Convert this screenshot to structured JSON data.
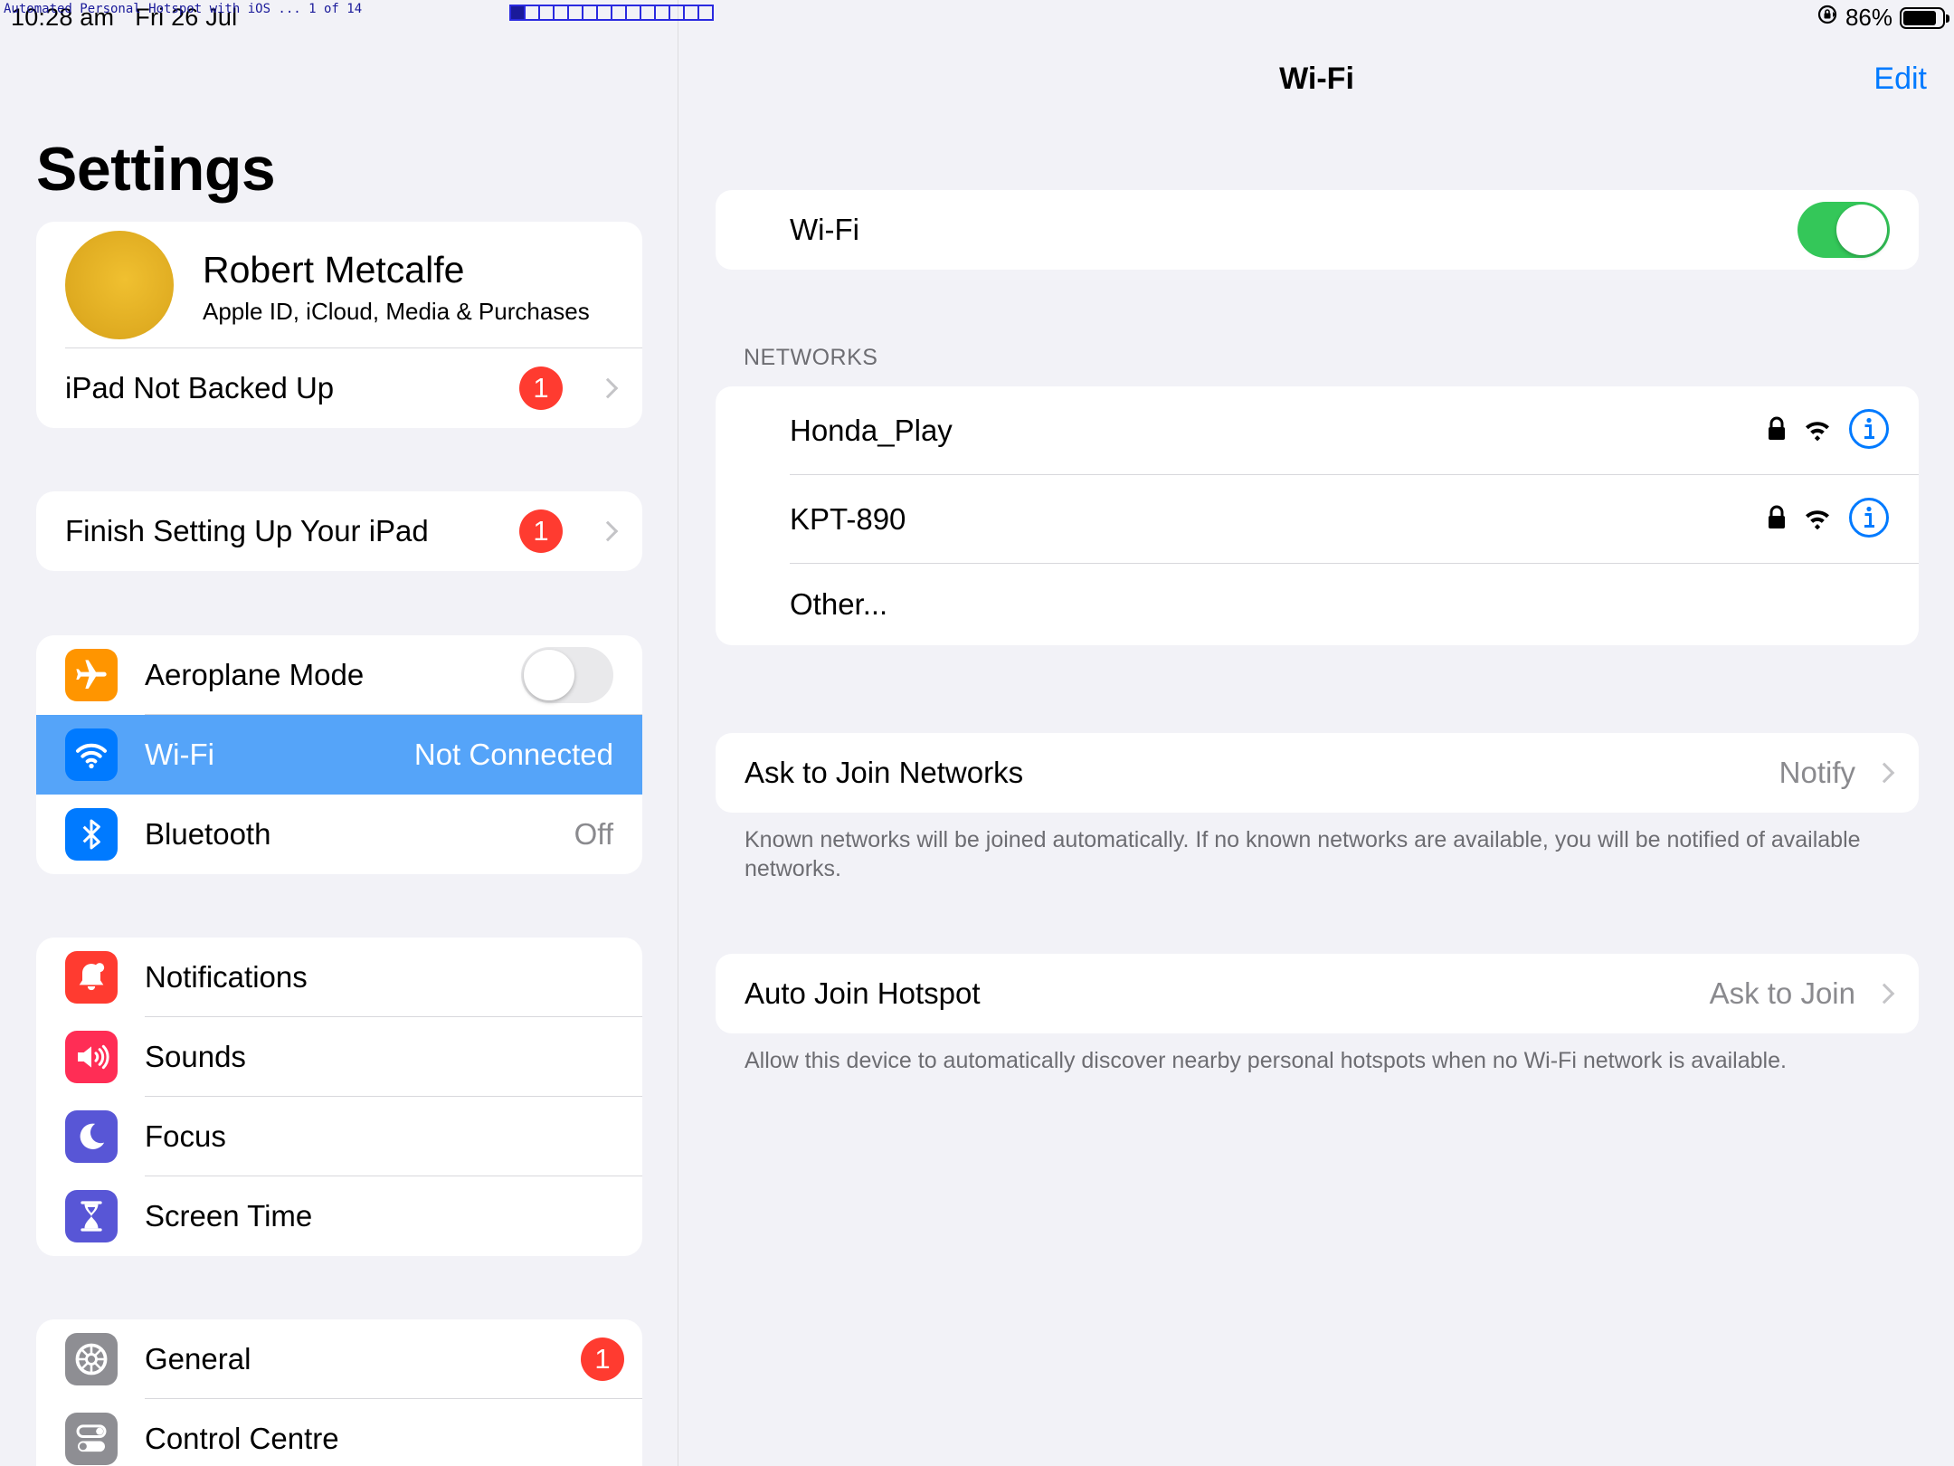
{
  "status": {
    "time": "10:28 am",
    "date": "Fri 26 Jul",
    "recording_label": "Automated Personal Hotspot with iOS ... 1 of 14",
    "recording_current": 1,
    "recording_total": 14,
    "battery": "86%",
    "battery_level": 0.86
  },
  "sidebar": {
    "title": "Settings",
    "profile": {
      "name": "Robert Metcalfe",
      "subtitle": "Apple ID, iCloud, Media & Purchases"
    },
    "backup": {
      "label": "iPad Not Backed Up",
      "badge": "1"
    },
    "setup": {
      "label": "Finish Setting Up Your iPad",
      "badge": "1"
    },
    "connectivity": [
      {
        "label": "Aeroplane Mode",
        "icon": "airplane-icon",
        "color": "#ff9500",
        "toggle": false
      },
      {
        "label": "Wi-Fi",
        "icon": "wifi-icon",
        "color": "#007aff",
        "value": "Not Connected"
      },
      {
        "label": "Bluetooth",
        "icon": "bluetooth-icon",
        "color": "#007aff",
        "value": "Off"
      }
    ],
    "alerts": [
      {
        "label": "Notifications",
        "icon": "bell-icon",
        "color": "#ff3b30"
      },
      {
        "label": "Sounds",
        "icon": "speaker-icon",
        "color": "#ff2d55"
      },
      {
        "label": "Focus",
        "icon": "moon-icon",
        "color": "#5856d6"
      },
      {
        "label": "Screen Time",
        "icon": "hourglass-icon",
        "color": "#5856d6"
      }
    ],
    "system": [
      {
        "label": "General",
        "icon": "gear-icon",
        "color": "#8e8e93",
        "badge": "1"
      },
      {
        "label": "Control Centre",
        "icon": "switches-icon",
        "color": "#8e8e93"
      }
    ],
    "selection_color": "#55a4f9"
  },
  "detail": {
    "title": "Wi-Fi",
    "edit": "Edit",
    "wifi_toggle": {
      "label": "Wi-Fi",
      "on": true
    },
    "networks_header": "NETWORKS",
    "networks": [
      {
        "name": "Honda_Play",
        "locked": true
      },
      {
        "name": "KPT-890",
        "locked": true
      }
    ],
    "other": "Other...",
    "ask_to_join": {
      "label": "Ask to Join Networks",
      "value": "Notify",
      "footnote": "Known networks will be joined automatically. If no known networks are available, you will be notified of available networks."
    },
    "auto_join": {
      "label": "Auto Join Hotspot",
      "value": "Ask to Join",
      "footnote": "Allow this device to automatically discover nearby personal hotspots when no Wi-Fi network is available."
    },
    "accent": "#007aff"
  }
}
